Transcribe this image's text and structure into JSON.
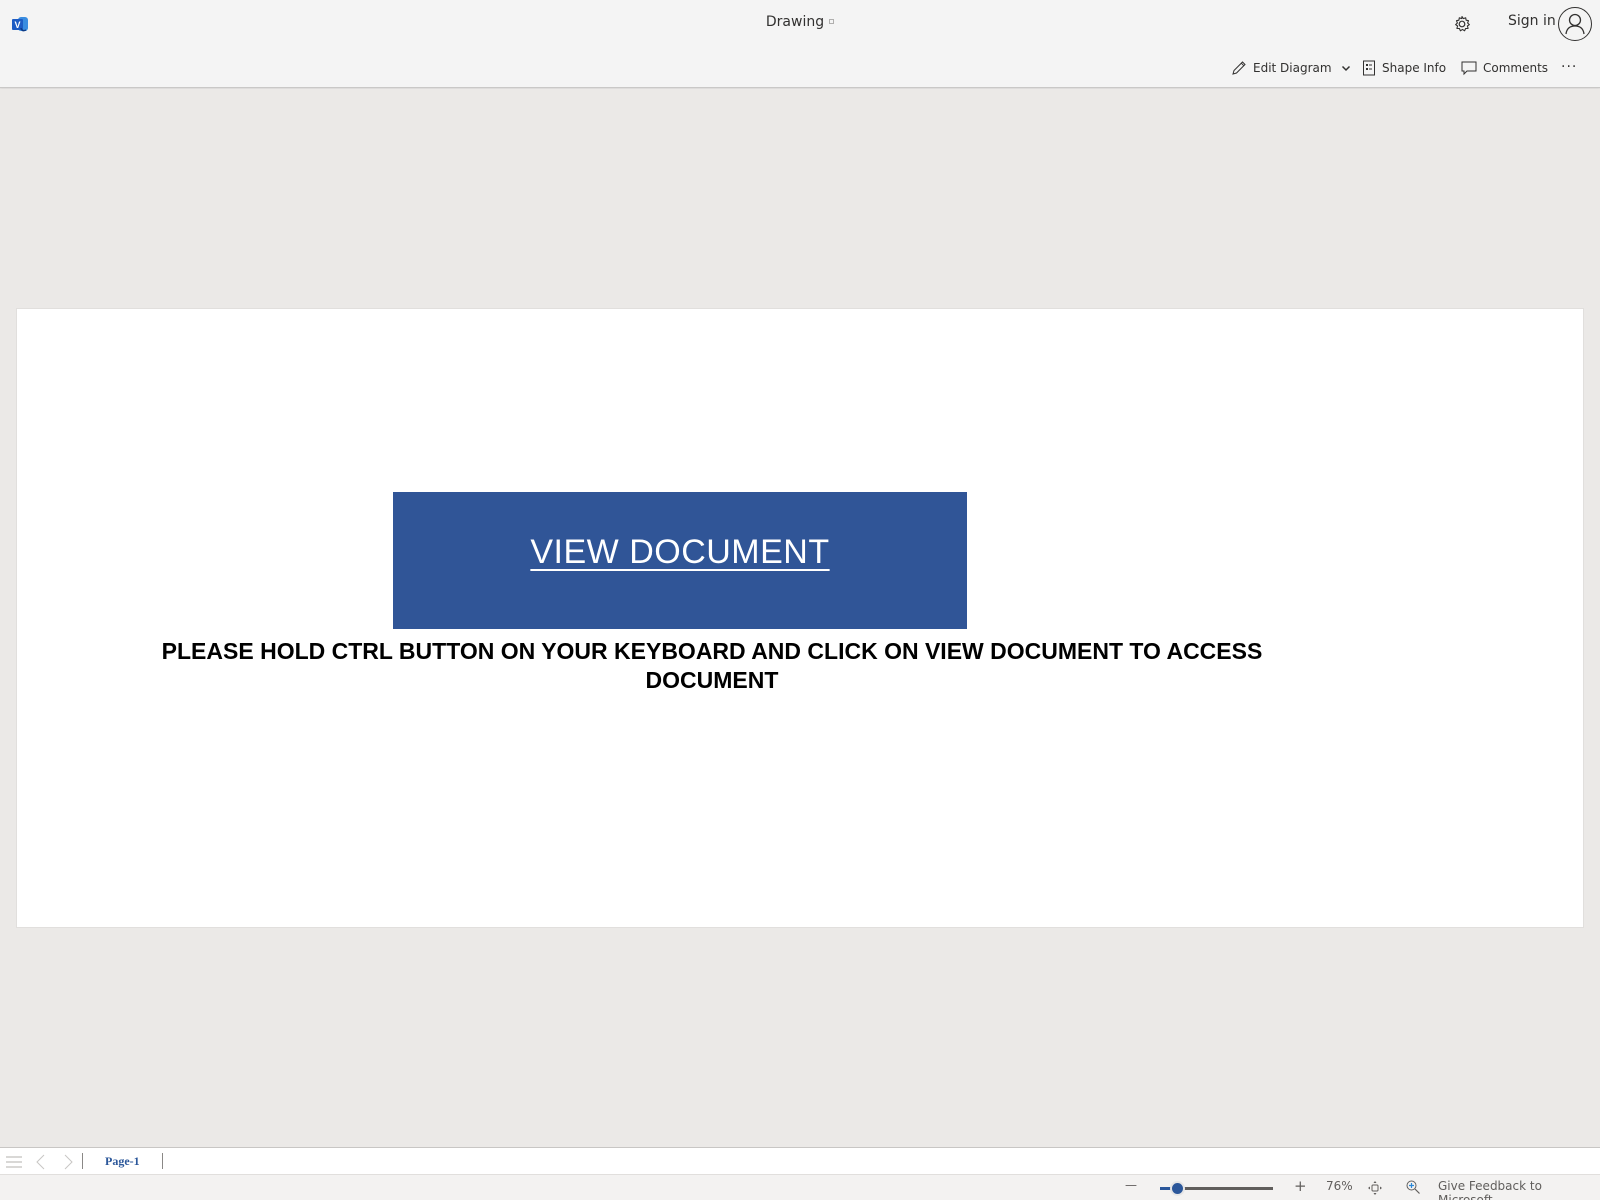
{
  "header": {
    "app_icon": "visio-logo-icon",
    "title": "Drawing",
    "settings_icon": "gear-icon",
    "signin_label": "Sign in",
    "avatar_icon": "person-icon"
  },
  "toolbar": {
    "edit_diagram_label": "Edit Diagram",
    "shape_info_label": "Shape Info",
    "comments_label": "Comments",
    "more_label": "···"
  },
  "canvas": {
    "view_document_label": "VIEW DOCUMENT",
    "view_document_color": "#305597",
    "instructions": "PLEASE HOLD CTRL BUTTON ON YOUR KEYBOARD AND CLICK ON VIEW DOCUMENT TO ACCESS DOCUMENT"
  },
  "page_tabs": {
    "tabs": [
      {
        "label": "Page-1",
        "active": true
      }
    ]
  },
  "status_bar": {
    "zoom_out_label": "—",
    "zoom_in_label": "+",
    "zoom_level": "76%",
    "zoom_fraction": 0.15,
    "feedback_label": "Give Feedback to Microsoft"
  }
}
